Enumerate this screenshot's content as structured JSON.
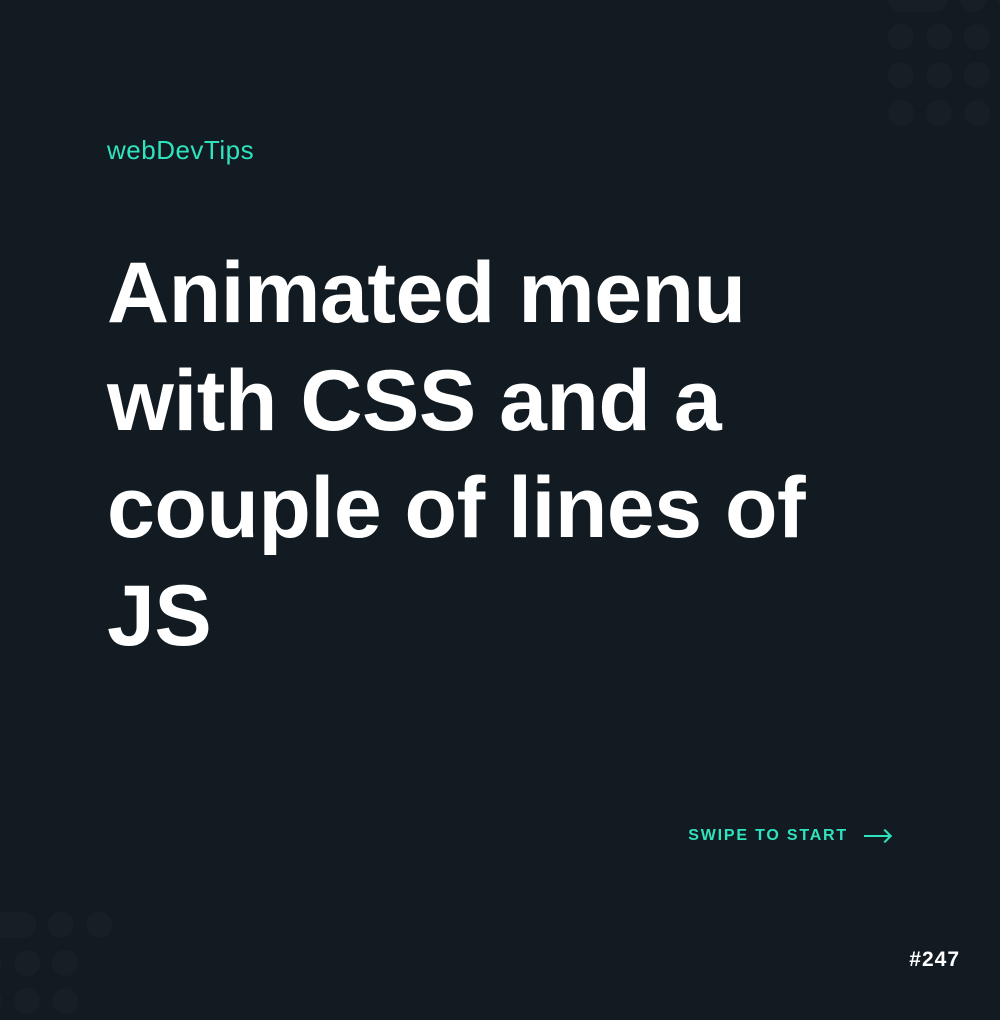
{
  "brand": "webDevTips",
  "title": "Animated menu with CSS and a couple of lines of JS",
  "cta": "SWIPE TO START",
  "tip_number": "#247",
  "colors": {
    "background": "#121b21",
    "accent": "#2fe3bf",
    "text": "#ffffff"
  }
}
